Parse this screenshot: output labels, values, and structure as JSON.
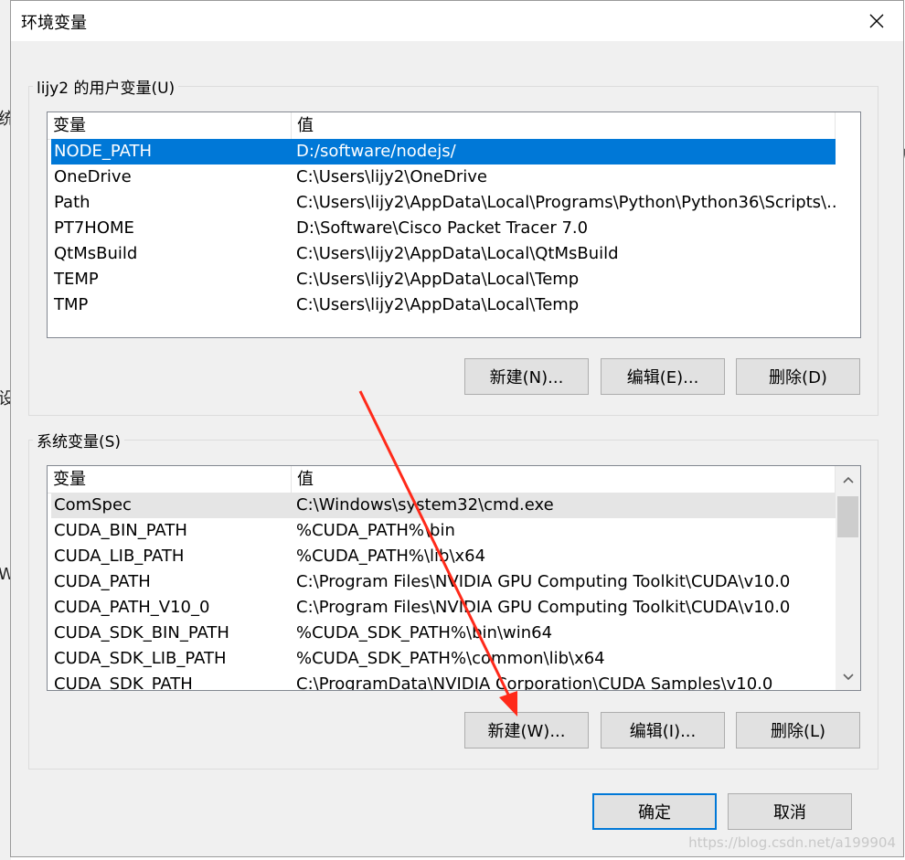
{
  "dialog": {
    "title": "环境变量",
    "close_glyph": "✕"
  },
  "user_group": {
    "label": "lijy2 的用户变量(U)",
    "columns": [
      "变量",
      "值"
    ],
    "rows": [
      {
        "name": "NODE_PATH",
        "value": "D:/software/nodejs/"
      },
      {
        "name": "OneDrive",
        "value": "C:\\Users\\lijy2\\OneDrive"
      },
      {
        "name": "Path",
        "value": "C:\\Users\\lijy2\\AppData\\Local\\Programs\\Python\\Python36\\Scripts\\..."
      },
      {
        "name": "PT7HOME",
        "value": "D:\\Software\\Cisco Packet Tracer 7.0"
      },
      {
        "name": "QtMsBuild",
        "value": "C:\\Users\\lijy2\\AppData\\Local\\QtMsBuild"
      },
      {
        "name": "TEMP",
        "value": "C:\\Users\\lijy2\\AppData\\Local\\Temp"
      },
      {
        "name": "TMP",
        "value": "C:\\Users\\lijy2\\AppData\\Local\\Temp"
      }
    ],
    "buttons": {
      "new": "新建(N)...",
      "edit": "编辑(E)...",
      "delete": "删除(D)"
    }
  },
  "system_group": {
    "label": "系统变量(S)",
    "columns": [
      "变量",
      "值"
    ],
    "rows": [
      {
        "name": "ComSpec",
        "value": "C:\\Windows\\system32\\cmd.exe"
      },
      {
        "name": "CUDA_BIN_PATH",
        "value": "%CUDA_PATH%\\bin"
      },
      {
        "name": "CUDA_LIB_PATH",
        "value": "%CUDA_PATH%\\lib\\x64"
      },
      {
        "name": "CUDA_PATH",
        "value": "C:\\Program Files\\NVIDIA GPU Computing Toolkit\\CUDA\\v10.0"
      },
      {
        "name": "CUDA_PATH_V10_0",
        "value": "C:\\Program Files\\NVIDIA GPU Computing Toolkit\\CUDA\\v10.0"
      },
      {
        "name": "CUDA_SDK_BIN_PATH",
        "value": "%CUDA_SDK_PATH%\\bin\\win64"
      },
      {
        "name": "CUDA_SDK_LIB_PATH",
        "value": "%CUDA_SDK_PATH%\\common\\lib\\x64"
      },
      {
        "name": "CUDA_SDK_PATH",
        "value": "C:\\ProgramData\\NVIDIA Corporation\\CUDA Samples\\v10.0"
      }
    ],
    "buttons": {
      "new": "新建(W)...",
      "edit": "编辑(I)...",
      "delete": "删除(L)"
    }
  },
  "footer": {
    "ok": "确定",
    "cancel": "取消"
  },
  "watermark": "https://blog.csdn.net/a199904",
  "background_fragments": [
    "统",
    "设",
    "W",
    "W"
  ],
  "colors": {
    "selection": "#0078d7",
    "annotation_arrow": "#ff2a1a"
  }
}
